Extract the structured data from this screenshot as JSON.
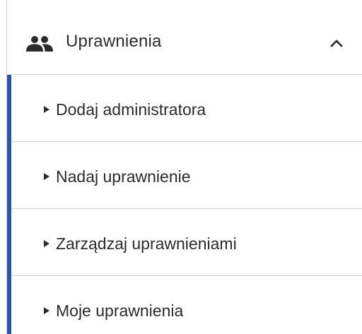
{
  "menu": {
    "section_title": "Uprawnienia",
    "section_icon": "people-icon",
    "expanded_icon": "chevron-up-icon",
    "expanded": true,
    "accent_color": "#2b55a8",
    "items": [
      {
        "label": "Dodaj administratora",
        "icon": "triangle-right-icon"
      },
      {
        "label": "Nadaj uprawnienie",
        "icon": "triangle-right-icon"
      },
      {
        "label": "Zarządzaj uprawnieniami",
        "icon": "triangle-right-icon"
      },
      {
        "label": "Moje uprawnienia",
        "icon": "triangle-right-icon"
      }
    ]
  }
}
